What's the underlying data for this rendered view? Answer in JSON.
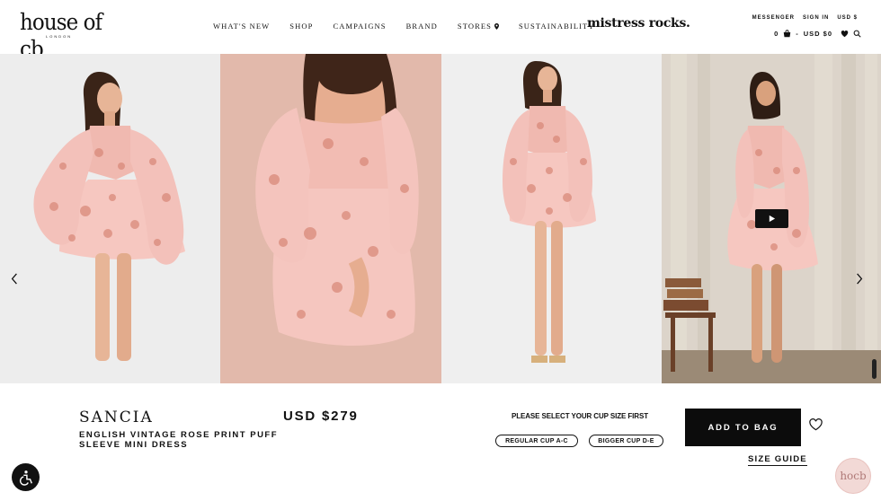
{
  "header": {
    "logo": "house of cb",
    "logo_sub": "LONDON",
    "nav": [
      "WHAT'S NEW",
      "SHOP",
      "CAMPAIGNS",
      "BRAND",
      "STORES",
      "SUSTAINABILITY"
    ],
    "campaign_link": "mistress rocks.",
    "utility_top": [
      "MESSENGER",
      "SIGN IN",
      "USD $"
    ],
    "bag_count": "0",
    "bag_separator": "-",
    "bag_total": "USD $0"
  },
  "gallery": {
    "icons": {
      "prev": "chevron-left-icon",
      "next": "chevron-right-icon",
      "play": "play-icon"
    }
  },
  "product": {
    "name": "SANCIA",
    "description": "ENGLISH VINTAGE ROSE PRINT PUFF SLEEVE MINI DRESS",
    "price": "USD $279",
    "cup_prompt": "PLEASE SELECT YOUR CUP SIZE FIRST",
    "cup_options": [
      "REGULAR CUP A-C",
      "BIGGER CUP D-E"
    ],
    "add_to_bag": "ADD TO BAG",
    "size_guide": "SIZE GUIDE"
  },
  "chat_badge": "hocb",
  "colors": {
    "accent": "#0c0c0c",
    "dress": "#f4c2bc",
    "rose": "#d98a7a"
  }
}
